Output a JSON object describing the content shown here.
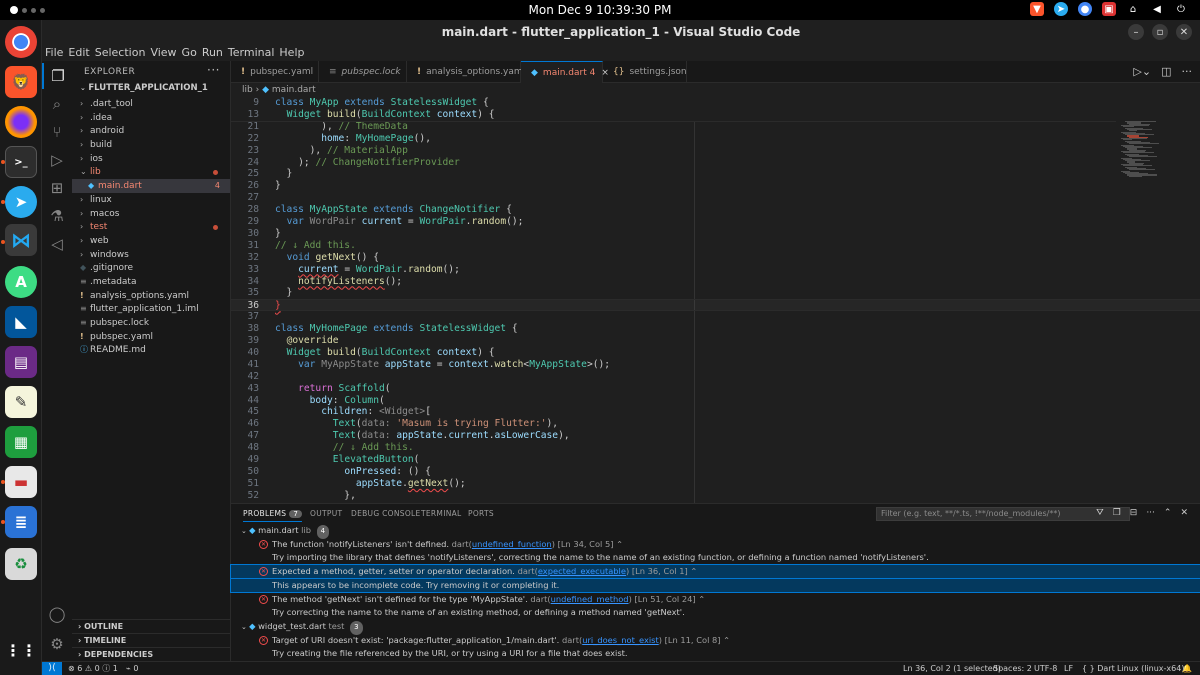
{
  "topbar": {
    "clock": "Mon Dec 9  10:39:30 PM"
  },
  "window": {
    "title": "main.dart - flutter_application_1 - Visual Studio Code"
  },
  "menu": [
    "File",
    "Edit",
    "Selection",
    "View",
    "Go",
    "Run",
    "Terminal",
    "Help"
  ],
  "explorer": {
    "header": "EXPLORER",
    "more": "···",
    "project": "FLUTTER_APPLICATION_1",
    "items": [
      {
        "label": ".dart_tool",
        "type": "folder"
      },
      {
        "label": ".idea",
        "type": "folder"
      },
      {
        "label": "android",
        "type": "folder"
      },
      {
        "label": "build",
        "type": "folder"
      },
      {
        "label": "ios",
        "type": "folder"
      },
      {
        "label": "lib",
        "type": "folder-open"
      },
      {
        "label": "main.dart",
        "type": "dart",
        "count": "4"
      },
      {
        "label": "linux",
        "type": "folder"
      },
      {
        "label": "macos",
        "type": "folder"
      },
      {
        "label": "test",
        "type": "folder"
      },
      {
        "label": "web",
        "type": "folder"
      },
      {
        "label": "windows",
        "type": "folder"
      },
      {
        "label": ".gitignore",
        "type": "file"
      },
      {
        "label": ".metadata",
        "type": "file"
      },
      {
        "label": "analysis_options.yaml",
        "type": "yaml"
      },
      {
        "label": "flutter_application_1.iml",
        "type": "file"
      },
      {
        "label": "pubspec.lock",
        "type": "file"
      },
      {
        "label": "pubspec.yaml",
        "type": "yaml"
      },
      {
        "label": "README.md",
        "type": "md"
      }
    ],
    "sections": [
      "OUTLINE",
      "TIMELINE",
      "DEPENDENCIES"
    ]
  },
  "tabs": [
    {
      "label": "pubspec.yaml",
      "icon": "!"
    },
    {
      "label": "pubspec.lock",
      "icon": "≡"
    },
    {
      "label": "analysis_options.yaml",
      "icon": "!"
    },
    {
      "label": "main.dart 4",
      "icon": "◆"
    },
    {
      "label": "settings.json",
      "icon": "{}"
    }
  ],
  "breadcrumb": {
    "folder": "lib",
    "sep": "›",
    "file": "main.dart"
  },
  "editor": {
    "lines": [
      {
        "n": "9",
        "sticky": true,
        "html": "<span class=\"kw\">class</span> <span class=\"cls\">MyApp</span> <span class=\"kw\">extends</span> <span class=\"cls\">StatelessWidget</span> {"
      },
      {
        "n": "13",
        "sticky": true,
        "html": "  <span class=\"cls\">Widget</span> <span class=\"fn\">build</span>(<span class=\"cls\">BuildContext</span> <span class=\"prm\">context</span>) {"
      },
      {
        "n": "21",
        "html": "        ), <span class=\"cm\">// ThemeData</span>"
      },
      {
        "n": "22",
        "html": "        <span class=\"prm\">home</span>: <span class=\"cls\">MyHomePage</span>(),"
      },
      {
        "n": "23",
        "html": "      ), <span class=\"cm\">// MaterialApp</span>"
      },
      {
        "n": "24",
        "html": "    ); <span class=\"cm\">// ChangeNotifierProvider</span>"
      },
      {
        "n": "25",
        "html": "  }"
      },
      {
        "n": "26",
        "html": "}"
      },
      {
        "n": "27",
        "html": ""
      },
      {
        "n": "28",
        "html": "<span class=\"kw\">class</span> <span class=\"cls\">MyAppState</span> <span class=\"kw\">extends</span> <span class=\"cls\">ChangeNotifier</span> {"
      },
      {
        "n": "29",
        "html": "  <span class=\"kw\">var</span> <span class=\"cmg\">WordPair</span> <span class=\"prm\">current</span> = <span class=\"cls\">WordPair</span>.<span class=\"fn\">random</span>();"
      },
      {
        "n": "30",
        "html": "}"
      },
      {
        "n": "31",
        "html": "<span class=\"cm\">// ↓ Add this.</span>"
      },
      {
        "n": "32",
        "html": "  <span class=\"kw\">void</span> <span class=\"fn\">getNext</span>() {"
      },
      {
        "n": "33",
        "html": "    <span class=\"prm sq\">current</span> = <span class=\"cls\">WordPair</span>.<span class=\"fn\">random</span>();"
      },
      {
        "n": "34",
        "html": "    <span class=\"fn sq\">notifyListeners</span>();"
      },
      {
        "n": "35",
        "html": "  }"
      },
      {
        "n": "36",
        "cur": true,
        "html": "<span class=\"sq\" style=\"color:#f14c4c\">}</span>"
      },
      {
        "n": "37",
        "html": ""
      },
      {
        "n": "38",
        "html": "<span class=\"kw\">class</span> <span class=\"cls\">MyHomePage</span> <span class=\"kw\">extends</span> <span class=\"cls\">StatelessWidget</span> {"
      },
      {
        "n": "39",
        "html": "  <span class=\"fn\">@override</span>"
      },
      {
        "n": "40",
        "html": "  <span class=\"cls\">Widget</span> <span class=\"fn\">build</span>(<span class=\"cls\">BuildContext</span> <span class=\"prm\">context</span>) {"
      },
      {
        "n": "41",
        "html": "    <span class=\"kw\">var</span> <span class=\"cmg\">MyAppState</span> <span class=\"prm\">appState</span> = <span class=\"prm\">context</span>.<span class=\"fn\">watch</span>&lt;<span class=\"cls\">MyAppState</span>&gt;();"
      },
      {
        "n": "42",
        "html": ""
      },
      {
        "n": "43",
        "html": "    <span class=\"par\">return</span> <span class=\"cls\">Scaffold</span>("
      },
      {
        "n": "44",
        "html": "      <span class=\"prm\">body</span>: <span class=\"cls\">Column</span>("
      },
      {
        "n": "45",
        "html": "        <span class=\"prm\">children</span>: <span class=\"cmg\">&lt;Widget&gt;</span>["
      },
      {
        "n": "46",
        "html": "          <span class=\"cls\">Text</span>(<span class=\"cmg\">data:</span> <span class=\"str\">'Masum is trying Flutter:'</span>),"
      },
      {
        "n": "47",
        "html": "          <span class=\"cls\">Text</span>(<span class=\"cmg\">data:</span> <span class=\"prm\">appState</span>.<span class=\"prm\">current</span>.<span class=\"prm\">asLowerCase</span>),"
      },
      {
        "n": "48",
        "html": "          <span class=\"cm\">// ↓ Add this.</span>"
      },
      {
        "n": "49",
        "html": "          <span class=\"cls\">ElevatedButton</span>("
      },
      {
        "n": "50",
        "html": "            <span class=\"prm\">onPressed</span>: () {"
      },
      {
        "n": "51",
        "html": "              <span class=\"prm\">appState</span>.<span class=\"fn sq\">getNext</span>();"
      },
      {
        "n": "52",
        "html": "            },"
      }
    ]
  },
  "panel": {
    "tabs": [
      {
        "label": "PROBLEMS",
        "badge": "7"
      },
      {
        "label": "OUTPUT"
      },
      {
        "label": "DEBUG CONSOLE"
      },
      {
        "label": "TERMINAL"
      },
      {
        "label": "PORTS"
      }
    ],
    "filter_placeholder": "Filter (e.g. text, **/*.ts, !**/node_modules/**)",
    "rows": [
      {
        "kind": "file",
        "file": "main.dart",
        "dir": "lib",
        "count": "4"
      },
      {
        "kind": "error",
        "msg": "The function 'notifyListeners' isn't defined.",
        "src": "dart(",
        "code": "undefined_function",
        "loc": ")  [Ln 34, Col 5]"
      },
      {
        "kind": "hint",
        "msg": "Try importing the library that defines 'notifyListeners', correcting the name to the name of an existing function, or defining a function named 'notifyListeners'."
      },
      {
        "kind": "error",
        "sel": true,
        "msg": "Expected a method, getter, setter or operator declaration.",
        "src": "dart(",
        "code": "expected_executable",
        "loc": ")  [Ln 36, Col 1]"
      },
      {
        "kind": "hint",
        "sel": true,
        "msg": "This appears to be incomplete code. Try removing it or completing it."
      },
      {
        "kind": "error",
        "msg": "The method 'getNext' isn't defined for the type 'MyAppState'.",
        "src": "dart(",
        "code": "undefined_method",
        "loc": ")  [Ln 51, Col 24]"
      },
      {
        "kind": "hint",
        "msg": "Try correcting the name to the name of an existing method, or defining a method named 'getNext'."
      },
      {
        "kind": "file",
        "file": "widget_test.dart",
        "dir": "test",
        "count": "3"
      },
      {
        "kind": "error",
        "msg": "Target of URI doesn't exist: 'package:flutter_application_1/main.dart'.",
        "src": "dart(",
        "code": "uri_does_not_exist",
        "loc": ")  [Ln 11, Col 8]"
      },
      {
        "kind": "hint",
        "msg": "Try creating the file referenced by the URI, or try using a URI for a file that does exist."
      }
    ]
  },
  "status": {
    "problems_errors": "6",
    "problems_warnings": "0",
    "problems_info": "1",
    "ports": "0",
    "position": "Ln 36, Col 2 (1 selected)",
    "spaces": "Spaces: 2",
    "encoding": "UTF-8",
    "eol": "LF",
    "language": "Dart",
    "platform": "Linux (linux-x64)"
  }
}
